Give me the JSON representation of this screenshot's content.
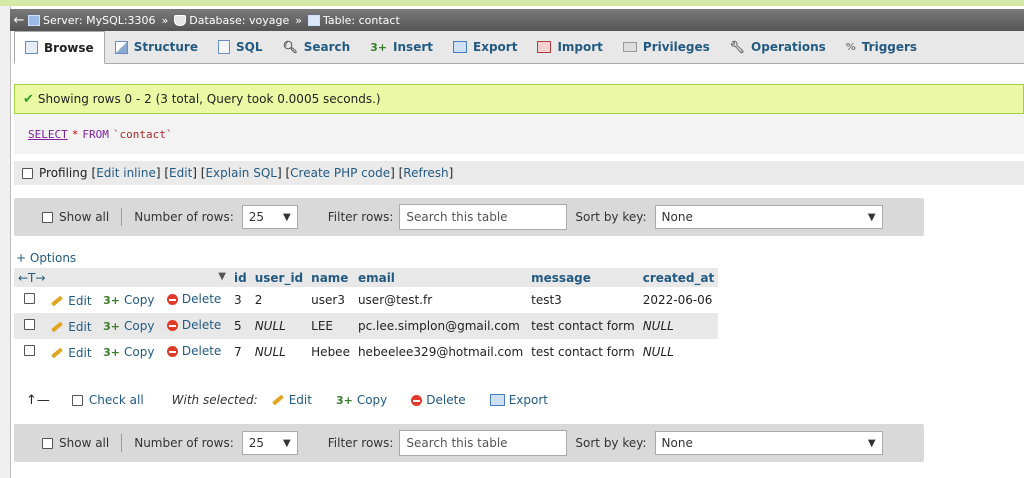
{
  "breadcrumb": {
    "server": "Server: MySQL:3306",
    "database": "Database: voyage",
    "table": "Table: contact",
    "separator": "»"
  },
  "tabs": [
    {
      "label": "Browse",
      "icon": "browse-icon",
      "active": true
    },
    {
      "label": "Structure",
      "icon": "structure-icon",
      "active": false
    },
    {
      "label": "SQL",
      "icon": "sql-icon",
      "active": false
    },
    {
      "label": "Search",
      "icon": "search-icon",
      "active": false
    },
    {
      "label": "Insert",
      "icon": "insert-icon",
      "active": false
    },
    {
      "label": "Export",
      "icon": "export-icon",
      "active": false
    },
    {
      "label": "Import",
      "icon": "import-icon",
      "active": false
    },
    {
      "label": "Privileges",
      "icon": "privileges-icon",
      "active": false
    },
    {
      "label": "Operations",
      "icon": "wrench-icon",
      "active": false
    },
    {
      "label": "Triggers",
      "icon": "triggers-icon",
      "active": false
    }
  ],
  "success_message": "Showing rows 0 - 2 (3 total, Query took 0.0005 seconds.)",
  "sql": {
    "select": "SELECT",
    "star": "*",
    "from": "FROM",
    "table": "`contact`"
  },
  "profiling": {
    "label": "Profiling",
    "links": [
      "Edit inline",
      "Edit",
      "Explain SQL",
      "Create PHP code",
      "Refresh"
    ]
  },
  "nav": {
    "show_all": "Show all",
    "number_of_rows_label": "Number of rows:",
    "number_of_rows_value": "25",
    "filter_label": "Filter rows:",
    "filter_placeholder": "Search this table",
    "sort_label": "Sort by key:",
    "sort_value": "None"
  },
  "options_label": "+ Options",
  "table": {
    "columns": [
      "id",
      "user_id",
      "name",
      "email",
      "message",
      "created_at"
    ],
    "rows": [
      {
        "id": "3",
        "user_id": "2",
        "name": "user3",
        "email": "user@test.fr",
        "message": "test3",
        "created_at": "2022-06-06"
      },
      {
        "id": "5",
        "user_id": "NULL",
        "name": "LEE",
        "email": "pc.lee.simplon@gmail.com",
        "message": "test contact form",
        "created_at": "NULL"
      },
      {
        "id": "7",
        "user_id": "NULL",
        "name": "Hebee",
        "email": "hebeelee329@hotmail.com",
        "message": "test contact form",
        "created_at": "NULL"
      }
    ],
    "actions": {
      "edit": "Edit",
      "copy": "Copy",
      "delete": "Delete"
    }
  },
  "bulk": {
    "check_all": "Check all",
    "with_selected": "With selected:",
    "edit": "Edit",
    "copy": "Copy",
    "delete": "Delete",
    "export": "Export"
  },
  "colors": {
    "accent": "#235a81",
    "success_bg": "#ebf8a4",
    "nav_bg": "#d9d9d9"
  }
}
